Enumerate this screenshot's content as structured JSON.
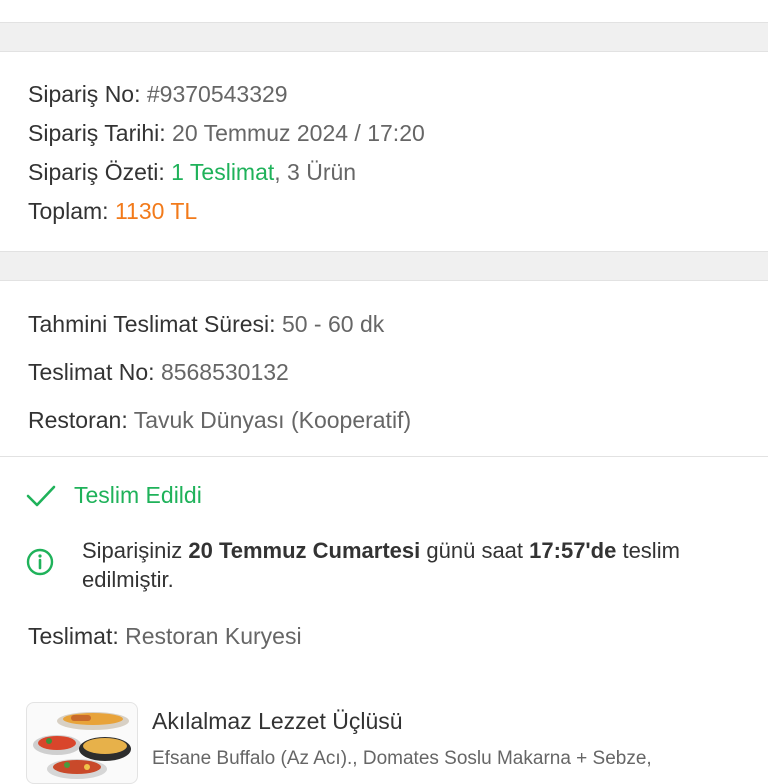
{
  "order": {
    "order_no_label": "Sipariş No:",
    "order_no_value": "#9370543329",
    "date_label": "Sipariş Tarihi:",
    "date_value": "20 Temmuz 2024 / 17:20",
    "summary_label": "Sipariş Özeti:",
    "summary_delivery": "1 Teslimat",
    "summary_sep": ",",
    "summary_items": " 3 Ürün",
    "total_label": "Toplam:",
    "total_value": "1130 TL"
  },
  "delivery": {
    "eta_label": "Tahmini Teslimat Süresi:",
    "eta_value": "50 - 60 dk",
    "delivery_no_label": "Teslimat No:",
    "delivery_no_value": "8568530132",
    "restaurant_label": "Restoran:",
    "restaurant_value": "Tavuk Dünyası (Kooperatif)",
    "status_text": "Teslim Edildi",
    "info_part1": "Siparişiniz ",
    "info_date": "20 Temmuz Cumartesi",
    "info_part2": " günü saat ",
    "info_time": "17:57'de",
    "info_part3": " teslim edilmiştir.",
    "method_label": "Teslimat:",
    "method_value": "Restoran Kuryesi"
  },
  "product": {
    "name": "Akılalmaz Lezzet Üçlüsü",
    "description": "Efsane Buffalo (Az Acı)., Domates Soslu Makarna + Sebze,"
  },
  "colors": {
    "accent_green": "#1fb25a",
    "accent_orange": "#f27a1a",
    "separator": "#f0f0f0"
  },
  "icons": {
    "status": "check-icon",
    "info": "info-circle-icon"
  }
}
